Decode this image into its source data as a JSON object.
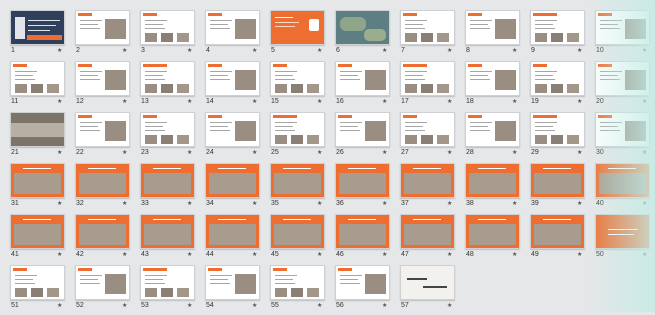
{
  "app": {
    "view": "slide-sorter"
  },
  "colors": {
    "background": "#e6e7e9",
    "accent": "#ee6d30",
    "slide_white": "#ffffff",
    "photo_tone": "#9a8e82",
    "map_tone": "#5d7f84",
    "text": "#333333"
  },
  "slides": [
    {
      "number": "1",
      "style": "cover"
    },
    {
      "number": "2",
      "style": "content"
    },
    {
      "number": "3",
      "style": "content"
    },
    {
      "number": "4",
      "style": "content"
    },
    {
      "number": "5",
      "style": "orange-full"
    },
    {
      "number": "6",
      "style": "map"
    },
    {
      "number": "7",
      "style": "content"
    },
    {
      "number": "8",
      "style": "content"
    },
    {
      "number": "9",
      "style": "content"
    },
    {
      "number": "10",
      "style": "content"
    },
    {
      "number": "11",
      "style": "content"
    },
    {
      "number": "12",
      "style": "content"
    },
    {
      "number": "13",
      "style": "content"
    },
    {
      "number": "14",
      "style": "content"
    },
    {
      "number": "15",
      "style": "content"
    },
    {
      "number": "16",
      "style": "content"
    },
    {
      "number": "17",
      "style": "content"
    },
    {
      "number": "18",
      "style": "content"
    },
    {
      "number": "19",
      "style": "content"
    },
    {
      "number": "20",
      "style": "content"
    },
    {
      "number": "21",
      "style": "photo"
    },
    {
      "number": "22",
      "style": "content"
    },
    {
      "number": "23",
      "style": "content"
    },
    {
      "number": "24",
      "style": "content"
    },
    {
      "number": "25",
      "style": "content"
    },
    {
      "number": "26",
      "style": "content"
    },
    {
      "number": "27",
      "style": "content"
    },
    {
      "number": "28",
      "style": "content"
    },
    {
      "number": "29",
      "style": "content"
    },
    {
      "number": "30",
      "style": "content"
    },
    {
      "number": "31",
      "style": "orange-header"
    },
    {
      "number": "32",
      "style": "orange-header"
    },
    {
      "number": "33",
      "style": "orange-header"
    },
    {
      "number": "34",
      "style": "orange-header"
    },
    {
      "number": "35",
      "style": "orange-header"
    },
    {
      "number": "36",
      "style": "orange-header"
    },
    {
      "number": "37",
      "style": "orange-header"
    },
    {
      "number": "38",
      "style": "orange-header"
    },
    {
      "number": "39",
      "style": "orange-header"
    },
    {
      "number": "40",
      "style": "orange-header"
    },
    {
      "number": "41",
      "style": "orange-header"
    },
    {
      "number": "42",
      "style": "orange-header"
    },
    {
      "number": "43",
      "style": "orange-header"
    },
    {
      "number": "44",
      "style": "orange-header"
    },
    {
      "number": "45",
      "style": "orange-header"
    },
    {
      "number": "46",
      "style": "orange-header"
    },
    {
      "number": "47",
      "style": "orange-header"
    },
    {
      "number": "48",
      "style": "orange-header"
    },
    {
      "number": "49",
      "style": "orange-header"
    },
    {
      "number": "50",
      "style": "orange-full"
    },
    {
      "number": "51",
      "style": "content"
    },
    {
      "number": "52",
      "style": "content"
    },
    {
      "number": "53",
      "style": "content"
    },
    {
      "number": "54",
      "style": "content"
    },
    {
      "number": "55",
      "style": "content"
    },
    {
      "number": "56",
      "style": "content"
    },
    {
      "number": "57",
      "style": "handwriting"
    }
  ],
  "star_glyph": "★"
}
